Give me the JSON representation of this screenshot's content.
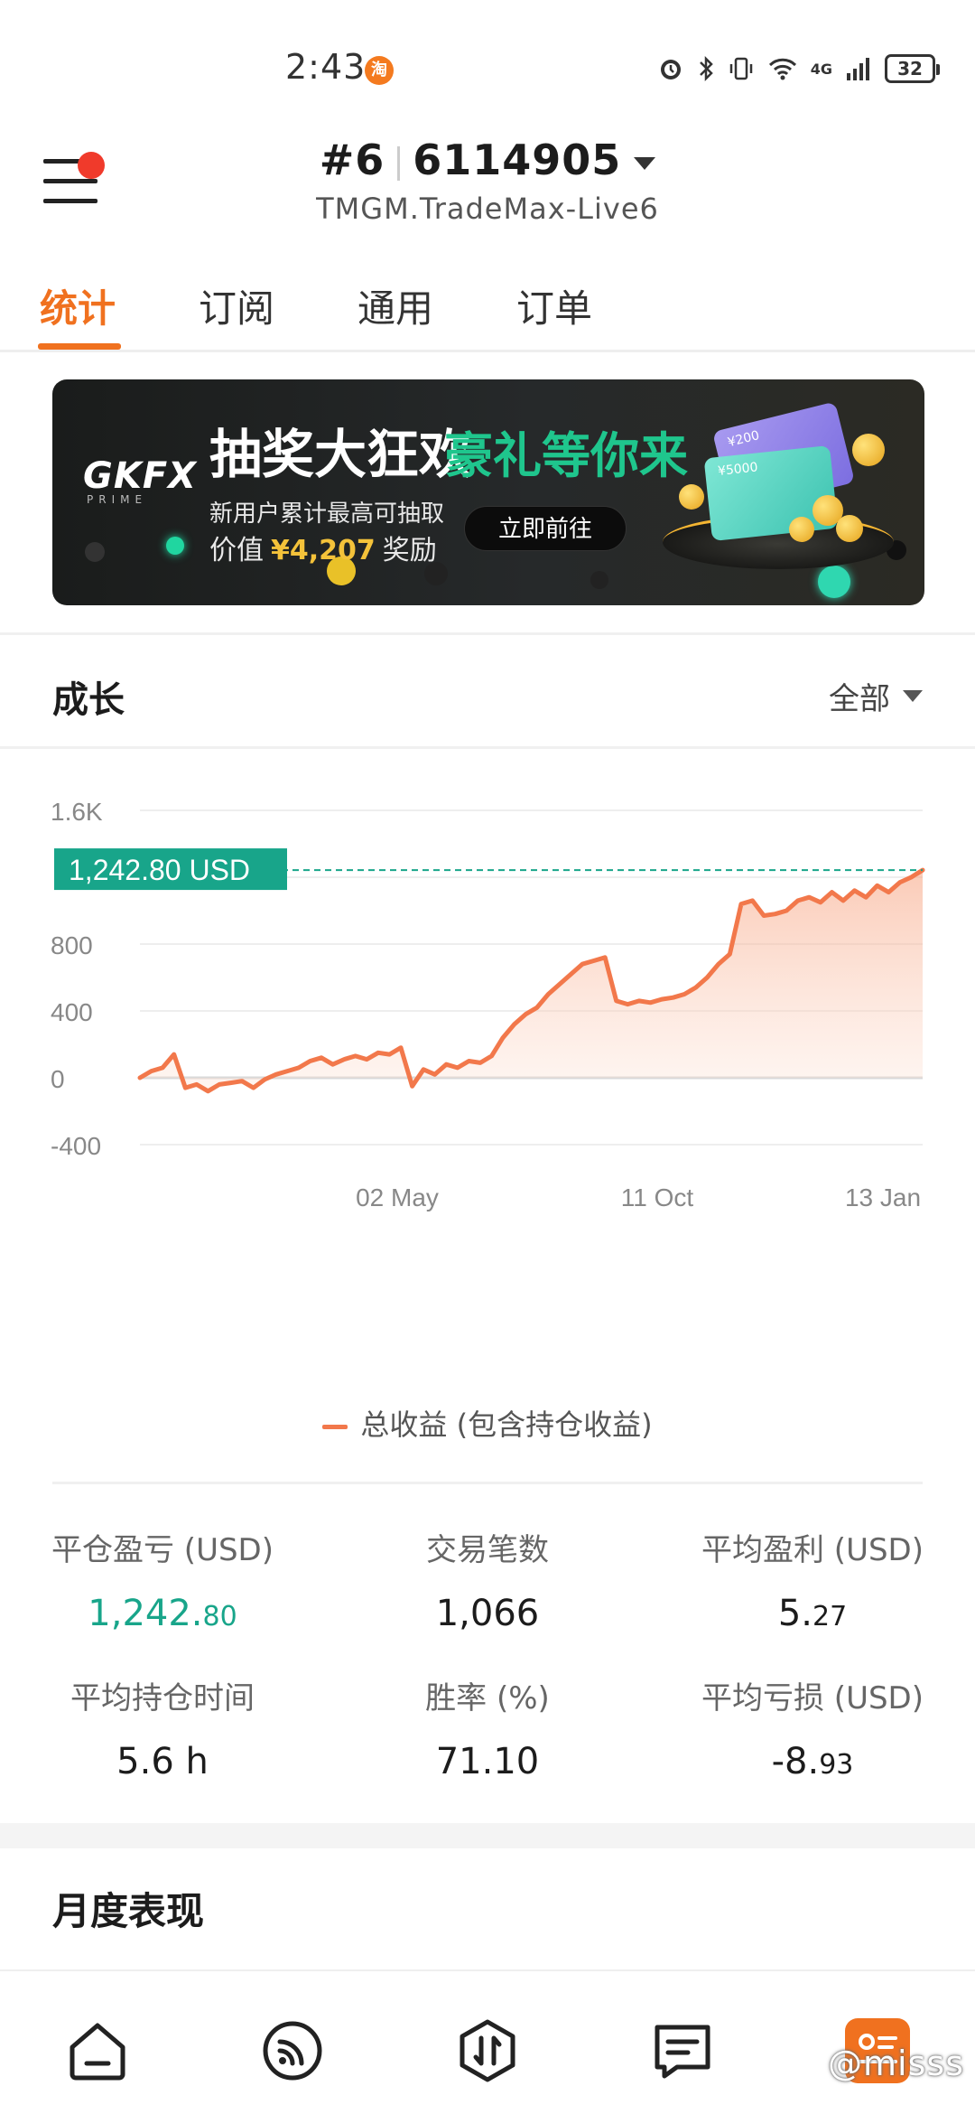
{
  "status_bar": {
    "time": "2:43",
    "app_badge": "淘",
    "network": "4G",
    "battery": "32"
  },
  "header": {
    "account_index": "#6",
    "account_number": "6114905",
    "server": "TMGM.TradeMax-Live6"
  },
  "tabs": [
    {
      "label": "统计",
      "active": true
    },
    {
      "label": "订阅",
      "active": false
    },
    {
      "label": "通用",
      "active": false
    },
    {
      "label": "订单",
      "active": false
    }
  ],
  "banner": {
    "brand": "GKFX",
    "brand_sub": "PRIME",
    "title_white": "抽奖大狂欢",
    "title_green": "豪礼等你来",
    "line1": "新用户累计最高可抽取",
    "line2_prefix": "价值",
    "line2_amount": "¥4,207",
    "line2_suffix": "奖励",
    "cta": "立即前往",
    "card1_text": "¥200",
    "card2_text": "¥5000"
  },
  "growth": {
    "title": "成长",
    "filter": "全部"
  },
  "chart_data": {
    "type": "area",
    "y_ticks": [
      "1.6K",
      "800",
      "400",
      "0",
      "-400"
    ],
    "x_ticks": [
      "02 May",
      "11 Oct",
      "13 Jan"
    ],
    "ylim": [
      -400,
      1600
    ],
    "current_value_label": "1,242.80 USD",
    "current_value": 1242.8,
    "legend": "总收益 (包含持仓收益)",
    "line_color": "#f2784b",
    "series": [
      {
        "name": "总收益 (包含持仓收益)",
        "values": [
          0,
          40,
          60,
          140,
          -60,
          -40,
          -80,
          -40,
          -30,
          -20,
          -60,
          -10,
          20,
          40,
          60,
          100,
          120,
          80,
          110,
          130,
          110,
          150,
          140,
          180,
          -50,
          50,
          20,
          80,
          60,
          100,
          90,
          130,
          240,
          320,
          380,
          420,
          500,
          560,
          620,
          680,
          700,
          720,
          460,
          440,
          460,
          450,
          470,
          480,
          500,
          540,
          600,
          680,
          740,
          1040,
          1060,
          970,
          980,
          1000,
          1060,
          1080,
          1050,
          1110,
          1060,
          1120,
          1080,
          1150,
          1110,
          1170,
          1200,
          1242.8
        ]
      }
    ]
  },
  "stats": [
    {
      "label": "平仓盈亏 (USD)",
      "int": "1,242.",
      "dec": "80",
      "green": true
    },
    {
      "label": "交易笔数",
      "int": "1,066",
      "dec": "",
      "green": false
    },
    {
      "label": "平均盈利 (USD)",
      "int": "5.",
      "dec": "27",
      "green": false
    },
    {
      "label": "平均持仓时间",
      "int": "5.6 h",
      "dec": "",
      "green": false
    },
    {
      "label": "胜率 (%)",
      "int": "71.10",
      "dec": "",
      "green": false
    },
    {
      "label": "平均亏损 (USD)",
      "int": "-8.",
      "dec": "93",
      "green": false
    }
  ],
  "monthly": {
    "title": "月度表现"
  },
  "bottom_nav": [
    "home-icon",
    "signal-icon",
    "trade-icon",
    "message-icon",
    "profile-icon"
  ],
  "watermark": "@misss"
}
